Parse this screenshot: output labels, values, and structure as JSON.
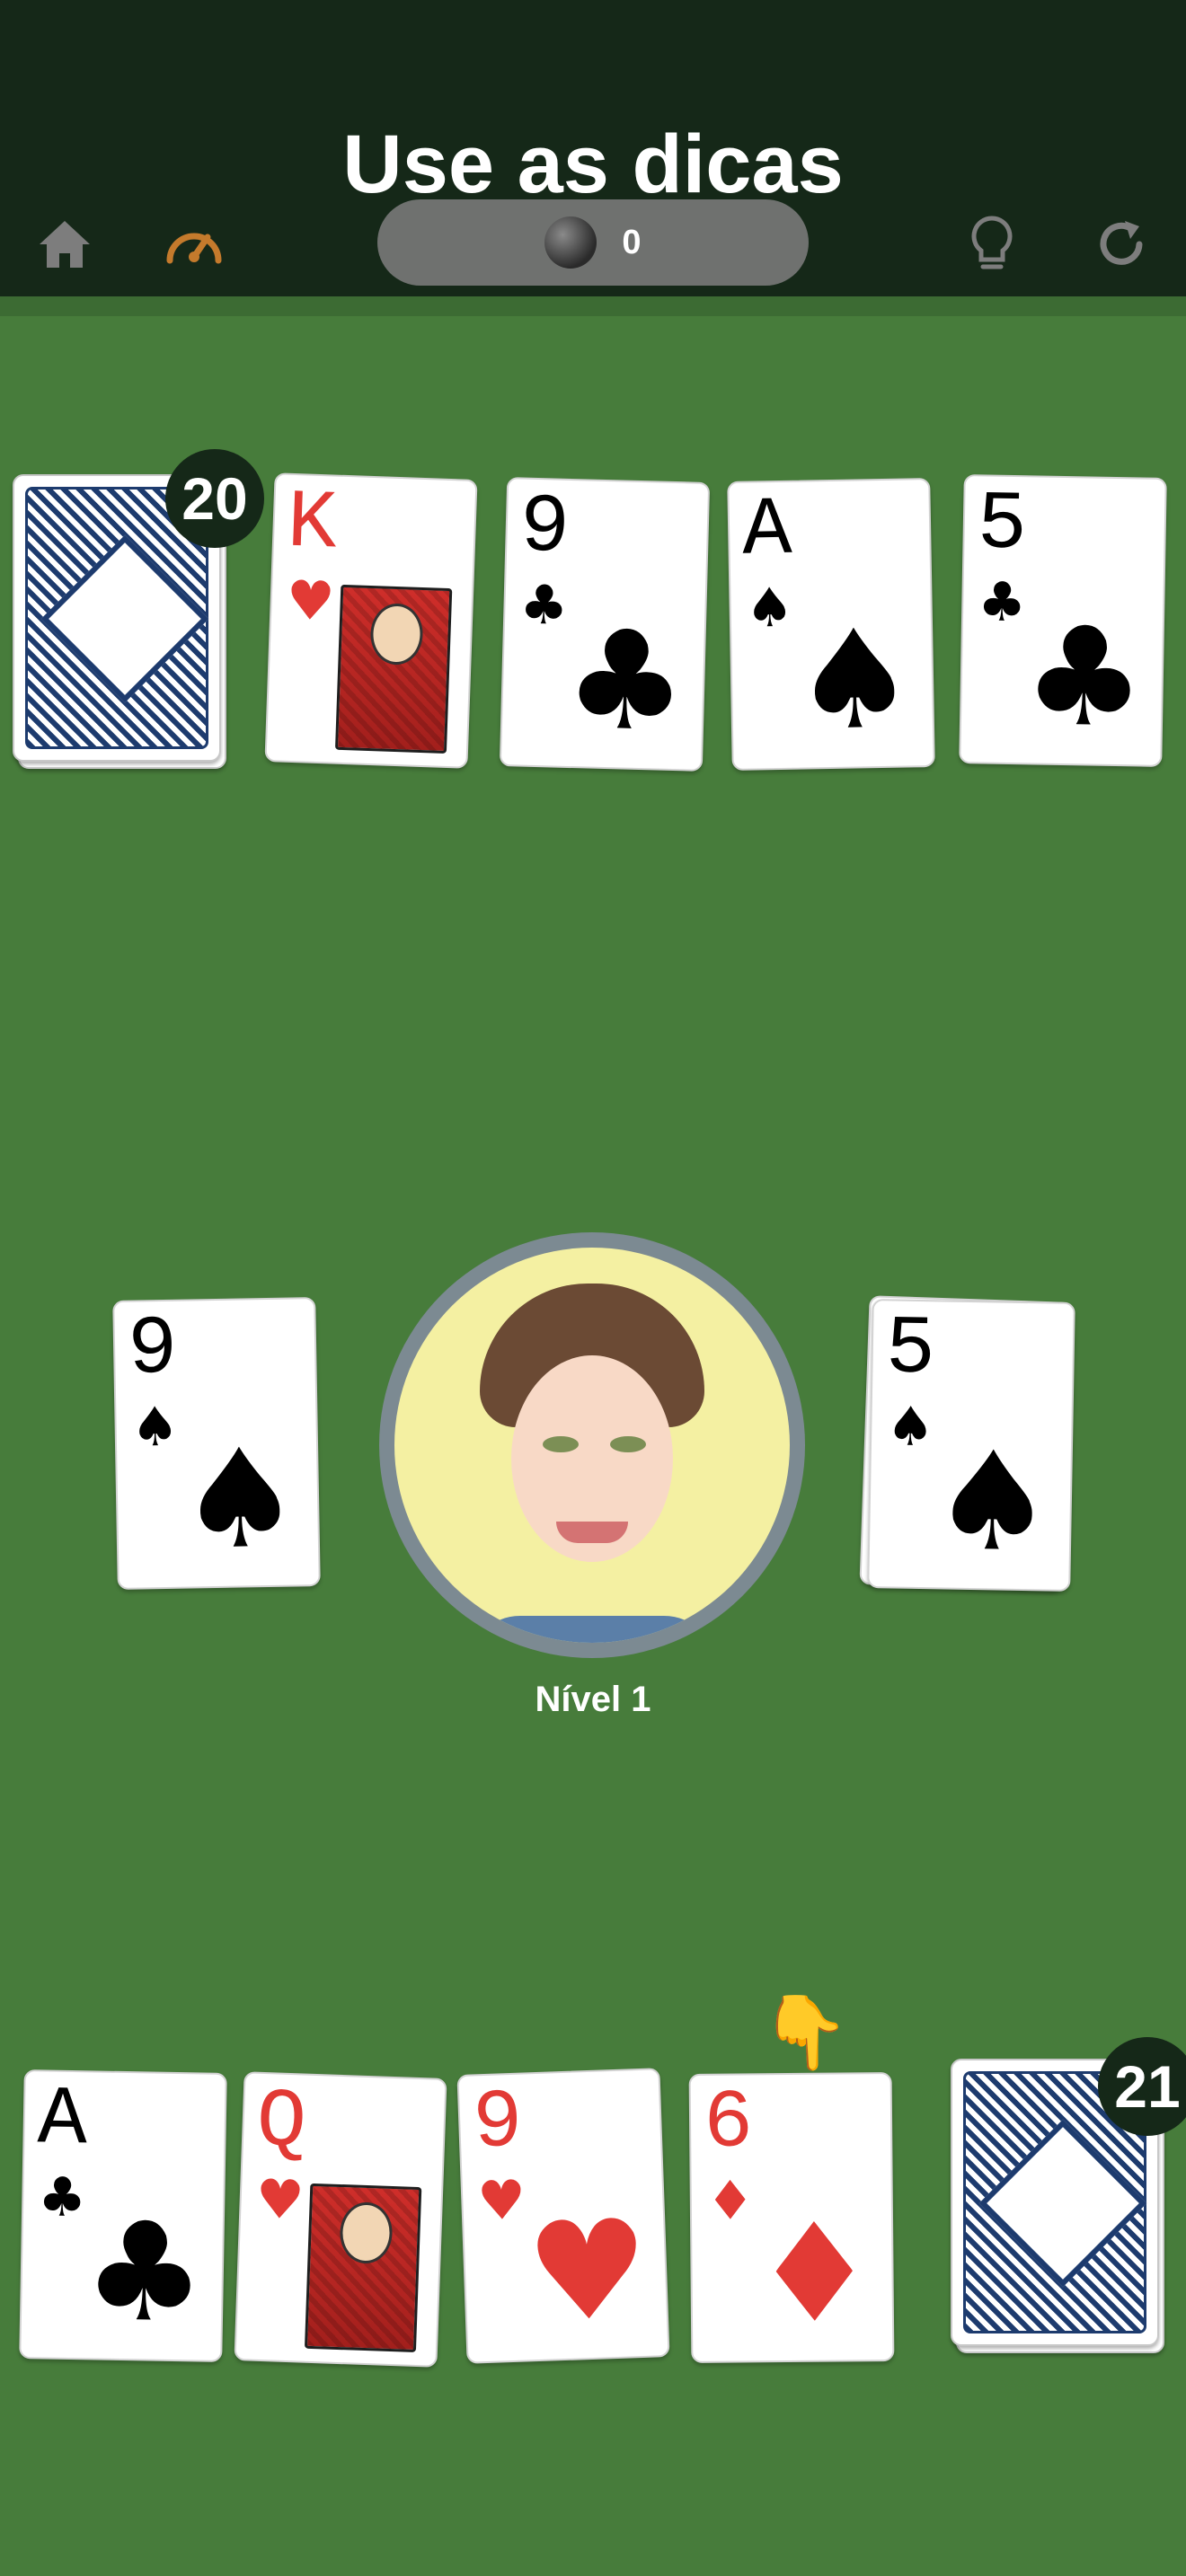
{
  "header": {
    "title": "Use as dicas",
    "coins": "0"
  },
  "opponent": {
    "deck_count": "20",
    "cards": [
      {
        "rank": "K",
        "suit": "♥",
        "color": "red",
        "face": true
      },
      {
        "rank": "9",
        "suit": "♣",
        "color": "black",
        "face": false
      },
      {
        "rank": "A",
        "suit": "♠",
        "color": "black",
        "face": false
      },
      {
        "rank": "5",
        "suit": "♣",
        "color": "black",
        "face": false
      }
    ]
  },
  "table": {
    "left_card": {
      "rank": "9",
      "suit": "♠",
      "color": "black"
    },
    "right_card": {
      "rank": "5",
      "suit": "♠",
      "color": "black"
    }
  },
  "avatar": {
    "level_label": "Nível 1"
  },
  "player": {
    "deck_count": "21",
    "cards": [
      {
        "rank": "A",
        "suit": "♣",
        "color": "black",
        "face": false
      },
      {
        "rank": "Q",
        "suit": "♥",
        "color": "red",
        "face": true
      },
      {
        "rank": "9",
        "suit": "♥",
        "color": "red",
        "face": false
      },
      {
        "rank": "6",
        "suit": "♦",
        "color": "red",
        "face": false
      }
    ],
    "hint_pointer": "👇"
  },
  "icons": {
    "home": "home-icon",
    "speed": "speedometer-icon",
    "hint": "lightbulb-icon",
    "restart": "restart-icon"
  },
  "colors": {
    "felt": "#477c3b",
    "header": "#152818",
    "accent_orange": "#c47a2c",
    "icon_gray": "#7d7d7d"
  }
}
